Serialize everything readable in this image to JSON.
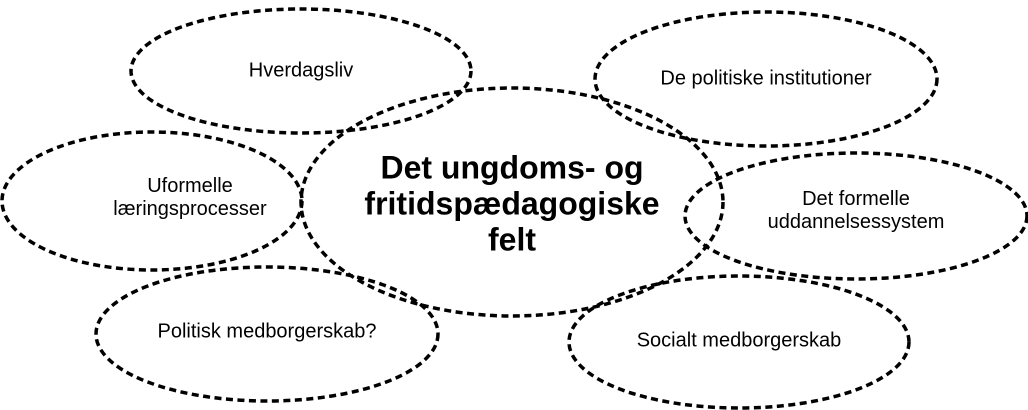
{
  "center": {
    "label": "Det ungdoms- og\nfritidspædagogiske\nfelt"
  },
  "bubbles": {
    "hverdagsliv": "Hverdagsliv",
    "politiske_institutioner": "De politiske institutioner",
    "uformelle": "Uformelle\nlæringsprocesser",
    "formelle": "Det formelle\nuddannelsessystem",
    "politisk_medborgerskab": "Politisk medborgerskab?",
    "socialt_medborgerskab": "Socialt medborgerskab"
  }
}
